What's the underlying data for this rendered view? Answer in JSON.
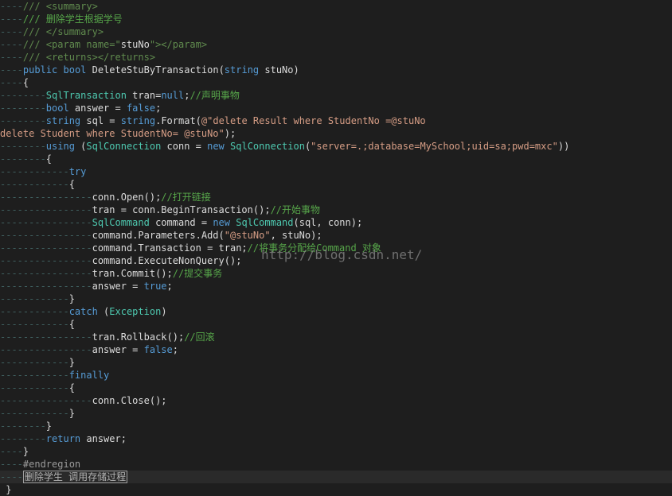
{
  "colors": {
    "background": "#1e1e1e",
    "plain": "#dcdcdc",
    "keyword": "#569cd6",
    "type": "#4ec9b0",
    "string": "#d69d85",
    "comment": "#57a64a",
    "xml_doc": "#608b4e",
    "indent_guide": "#3f5f5f"
  },
  "watermark": "http://blog.csdn.net/",
  "lines": [
    {
      "indent": 1,
      "tokens": [
        {
          "t": "/// <summary>",
          "c": "xml"
        }
      ]
    },
    {
      "indent": 1,
      "tokens": [
        {
          "t": "/// 删除学生根据学号",
          "c": "cm"
        }
      ]
    },
    {
      "indent": 1,
      "tokens": [
        {
          "t": "/// </summary>",
          "c": "xml"
        }
      ]
    },
    {
      "indent": 1,
      "tokens": [
        {
          "t": "/// <param name=\"",
          "c": "xml"
        },
        {
          "t": "stuNo",
          "c": "plain"
        },
        {
          "t": "\"></param>",
          "c": "xml"
        }
      ]
    },
    {
      "indent": 1,
      "tokens": [
        {
          "t": "/// <returns></returns>",
          "c": "xml"
        }
      ]
    },
    {
      "indent": 1,
      "tokens": [
        {
          "t": "public",
          "c": "kw"
        },
        {
          "t": " ",
          "c": "plain"
        },
        {
          "t": "bool",
          "c": "kw"
        },
        {
          "t": " DeleteStuByTransaction(",
          "c": "plain"
        },
        {
          "t": "string",
          "c": "kw"
        },
        {
          "t": " stuNo)",
          "c": "plain"
        }
      ]
    },
    {
      "indent": 1,
      "tokens": [
        {
          "t": "{",
          "c": "plain"
        }
      ]
    },
    {
      "indent": 2,
      "tokens": [
        {
          "t": "SqlTransaction",
          "c": "type"
        },
        {
          "t": " tran=",
          "c": "plain"
        },
        {
          "t": "null",
          "c": "kw"
        },
        {
          "t": ";",
          "c": "plain"
        },
        {
          "t": "//声明事物",
          "c": "cm"
        }
      ]
    },
    {
      "indent": 2,
      "tokens": [
        {
          "t": "bool",
          "c": "kw"
        },
        {
          "t": " answer = ",
          "c": "plain"
        },
        {
          "t": "false",
          "c": "kw"
        },
        {
          "t": ";",
          "c": "plain"
        }
      ]
    },
    {
      "indent": 2,
      "tokens": [
        {
          "t": "string",
          "c": "kw"
        },
        {
          "t": " sql = ",
          "c": "plain"
        },
        {
          "t": "string",
          "c": "kw"
        },
        {
          "t": ".Format(",
          "c": "plain"
        },
        {
          "t": "@\"delete Result where StudentNo =@stuNo",
          "c": "str"
        }
      ]
    },
    {
      "indent": 0,
      "tokens": [
        {
          "t": "delete Student where StudentNo= @stuNo\"",
          "c": "str"
        },
        {
          "t": ");",
          "c": "plain"
        }
      ]
    },
    {
      "indent": 2,
      "tokens": [
        {
          "t": "using",
          "c": "kw"
        },
        {
          "t": " (",
          "c": "plain"
        },
        {
          "t": "SqlConnection",
          "c": "type"
        },
        {
          "t": " conn = ",
          "c": "plain"
        },
        {
          "t": "new",
          "c": "kw"
        },
        {
          "t": " ",
          "c": "plain"
        },
        {
          "t": "SqlConnection",
          "c": "type"
        },
        {
          "t": "(",
          "c": "plain"
        },
        {
          "t": "\"server=.;database=MySchool;uid=sa;pwd=mxc\"",
          "c": "str"
        },
        {
          "t": "))",
          "c": "plain"
        }
      ]
    },
    {
      "indent": 2,
      "tokens": [
        {
          "t": "{",
          "c": "plain"
        }
      ]
    },
    {
      "indent": 3,
      "tokens": [
        {
          "t": "try",
          "c": "kw"
        }
      ]
    },
    {
      "indent": 3,
      "tokens": [
        {
          "t": "{",
          "c": "plain"
        }
      ]
    },
    {
      "indent": 4,
      "tokens": [
        {
          "t": "conn.Open();",
          "c": "plain"
        },
        {
          "t": "//打开链接",
          "c": "cm"
        }
      ]
    },
    {
      "indent": 4,
      "tokens": [
        {
          "t": "tran = conn.BeginTransaction();",
          "c": "plain"
        },
        {
          "t": "//开始事物",
          "c": "cm"
        }
      ]
    },
    {
      "indent": 4,
      "tokens": [
        {
          "t": "SqlCommand",
          "c": "type"
        },
        {
          "t": " command = ",
          "c": "plain"
        },
        {
          "t": "new",
          "c": "kw"
        },
        {
          "t": " ",
          "c": "plain"
        },
        {
          "t": "SqlCommand",
          "c": "type"
        },
        {
          "t": "(sql, conn);",
          "c": "plain"
        }
      ]
    },
    {
      "indent": 4,
      "tokens": [
        {
          "t": "command.Parameters.Add(",
          "c": "plain"
        },
        {
          "t": "\"@stuNo\"",
          "c": "str"
        },
        {
          "t": ", stuNo);",
          "c": "plain"
        }
      ]
    },
    {
      "indent": 4,
      "tokens": [
        {
          "t": "command.Transaction = tran;",
          "c": "plain"
        },
        {
          "t": "//将事务分配给Command 对象",
          "c": "cm"
        }
      ]
    },
    {
      "indent": 4,
      "tokens": [
        {
          "t": "command.ExecuteNonQuery();",
          "c": "plain"
        }
      ]
    },
    {
      "indent": 4,
      "tokens": [
        {
          "t": "tran.Commit();",
          "c": "plain"
        },
        {
          "t": "//提交事务",
          "c": "cm"
        }
      ]
    },
    {
      "indent": 4,
      "tokens": [
        {
          "t": "answer = ",
          "c": "plain"
        },
        {
          "t": "true",
          "c": "kw"
        },
        {
          "t": ";",
          "c": "plain"
        }
      ]
    },
    {
      "indent": 3,
      "tokens": [
        {
          "t": "}",
          "c": "plain"
        }
      ]
    },
    {
      "indent": 3,
      "tokens": [
        {
          "t": "catch",
          "c": "kw"
        },
        {
          "t": " (",
          "c": "plain"
        },
        {
          "t": "Exception",
          "c": "type"
        },
        {
          "t": ")",
          "c": "plain"
        }
      ]
    },
    {
      "indent": 3,
      "tokens": [
        {
          "t": "{",
          "c": "plain"
        }
      ]
    },
    {
      "indent": 4,
      "tokens": [
        {
          "t": "tran.Rollback();",
          "c": "plain"
        },
        {
          "t": "//回滚",
          "c": "cm"
        }
      ]
    },
    {
      "indent": 4,
      "tokens": [
        {
          "t": "answer = ",
          "c": "plain"
        },
        {
          "t": "false",
          "c": "kw"
        },
        {
          "t": ";",
          "c": "plain"
        }
      ]
    },
    {
      "indent": 3,
      "tokens": [
        {
          "t": "}",
          "c": "plain"
        }
      ]
    },
    {
      "indent": 3,
      "tokens": [
        {
          "t": "finally",
          "c": "kw"
        }
      ]
    },
    {
      "indent": 3,
      "tokens": [
        {
          "t": "{",
          "c": "plain"
        }
      ]
    },
    {
      "indent": 4,
      "tokens": [
        {
          "t": "conn.Close();",
          "c": "plain"
        }
      ]
    },
    {
      "indent": 3,
      "tokens": [
        {
          "t": "}",
          "c": "plain"
        }
      ]
    },
    {
      "indent": 2,
      "tokens": [
        {
          "t": "}",
          "c": "plain"
        }
      ]
    },
    {
      "indent": 2,
      "tokens": [
        {
          "t": "return",
          "c": "kw"
        },
        {
          "t": " answer;",
          "c": "plain"
        }
      ]
    },
    {
      "indent": 1,
      "tokens": [
        {
          "t": "}",
          "c": "plain"
        }
      ]
    },
    {
      "indent": 1,
      "tokens": [
        {
          "t": "#endregion",
          "c": "pre"
        }
      ]
    },
    {
      "indent": 1,
      "current": true,
      "tokens": [
        {
          "t": "删除学生 调用存储过程",
          "c": "boxed"
        }
      ]
    },
    {
      "indent": 0,
      "tokens": [
        {
          "t": " }",
          "c": "plain"
        }
      ]
    }
  ]
}
